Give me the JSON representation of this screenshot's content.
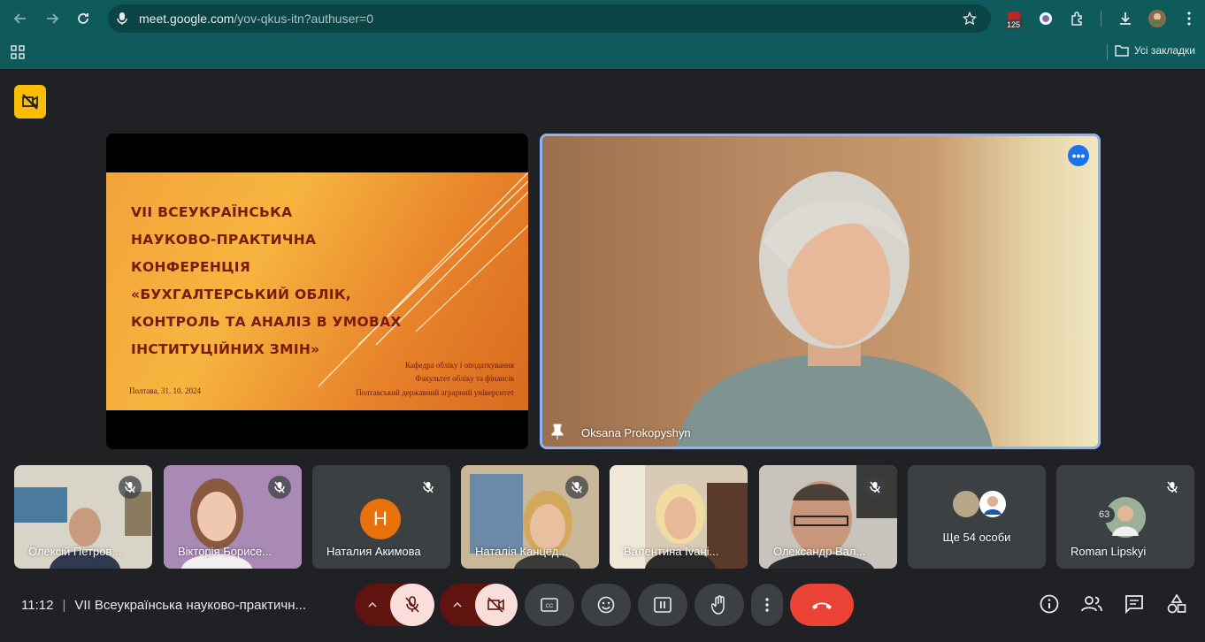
{
  "browser": {
    "url_host": "meet.google.com",
    "url_path": "/yov-qkus-itn?authuser=0",
    "extension_badge": "125",
    "bookmarks_label": "Усі закладки"
  },
  "slide": {
    "title_lines": [
      "VII ВСЕУКРАЇНСЬКА",
      "НАУКОВО-ПРАКТИЧНА КОНФЕРЕНЦІЯ",
      "«БУХГАЛТЕРСЬКИЙ ОБЛІК,",
      "КОНТРОЛЬ ТА АНАЛІЗ В УМОВАХ",
      "ІНСТИТУЦІЙНИХ ЗМІН»"
    ],
    "dept": "Кафедра обліку і оподаткування",
    "faculty": "Факультет обліку та фінансів",
    "university": "Полтавський державний аграрний університет",
    "date": "Полтава, 31. 10. 2024"
  },
  "speaker": {
    "name": "Oksana Prokopyshyn"
  },
  "participants": [
    {
      "name": "Олексій Петров..."
    },
    {
      "name": "Вікторія Борисе..."
    },
    {
      "name": "Наталия Акимова",
      "initial": "Н"
    },
    {
      "name": "Наталія Канцед..."
    },
    {
      "name": "Валентина Іvaні..."
    },
    {
      "name": "Олександр Вал..."
    },
    {
      "name": "Ще 54 особи"
    },
    {
      "name": "Roman Lipskyi"
    }
  ],
  "meeting": {
    "time": "11:12",
    "separator": "|",
    "title": "VII Всеукраїнська науково-практичн...",
    "people_count": "63"
  },
  "colors": {
    "accent": "#8ab4f8",
    "hangup": "#ea4335",
    "browser": "#0f5b5c",
    "warning": "#fbbc04"
  }
}
